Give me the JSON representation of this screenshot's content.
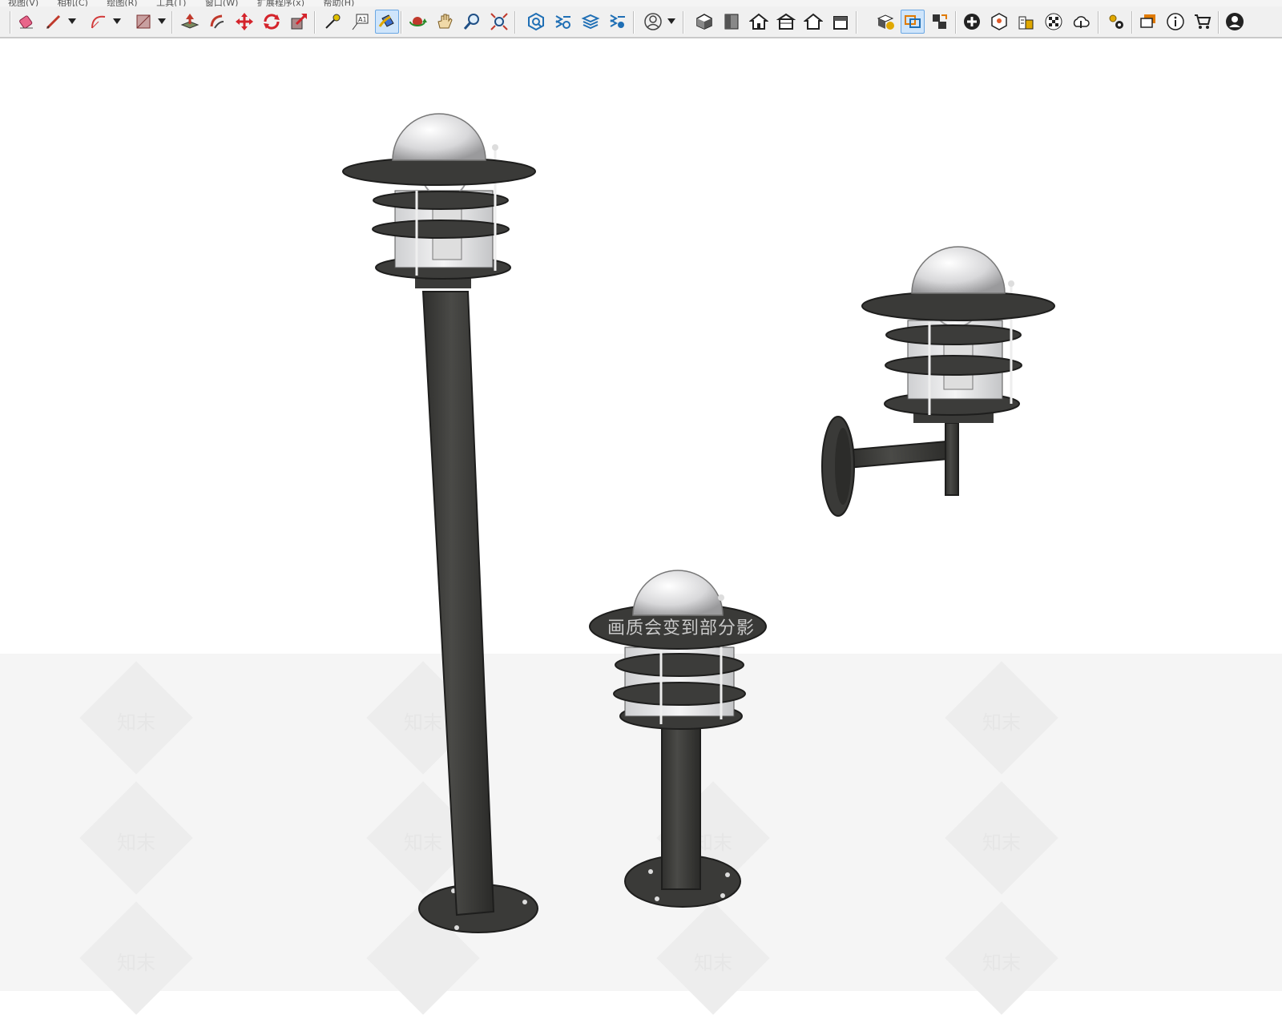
{
  "menu": {
    "items": [
      "视图(V)",
      "相机(C)",
      "绘图(R)",
      "工具(T)",
      "窗口(W)",
      "扩展程序(x)",
      "帮助(H)"
    ]
  },
  "toolbar": {
    "tools": [
      {
        "name": "eraser-icon",
        "color": "#e0406a"
      },
      {
        "name": "pencil-line-icon",
        "color": "#c0392b"
      },
      {
        "name": "arc-icon",
        "color": "#d23a3a"
      },
      {
        "name": "rectangle-icon",
        "color": "#b04040"
      },
      {
        "name": "push-pull-icon",
        "color": "#c0392b"
      },
      {
        "name": "follow-me-icon",
        "color": "#c0392b"
      },
      {
        "name": "move-icon",
        "color": "#d4232b"
      },
      {
        "name": "rotate-icon",
        "color": "#d4232b"
      },
      {
        "name": "scale-icon",
        "color": "#d4232b"
      },
      {
        "name": "tape-measure-icon",
        "color": "#d4b100"
      },
      {
        "name": "text-label-icon",
        "color": "#333333"
      },
      {
        "name": "paint-bucket-icon",
        "color": "#e0a800"
      },
      {
        "name": "orbit-icon",
        "color": "#c0392b"
      },
      {
        "name": "pan-icon",
        "color": "#e0b060"
      },
      {
        "name": "zoom-icon",
        "color": "#1f6fb5"
      },
      {
        "name": "zoom-extents-icon",
        "color": "#c0392b"
      },
      {
        "name": "warehouse-icon",
        "color": "#1f6fb5"
      },
      {
        "name": "extension-warehouse-icon",
        "color": "#1f6fb5"
      },
      {
        "name": "layers-icon",
        "color": "#1f6fb5"
      },
      {
        "name": "extension-manager-icon",
        "color": "#1f6fb5"
      },
      {
        "name": "user-account-icon",
        "color": "#444444"
      },
      {
        "name": "iso-view-icon",
        "color": "#333333"
      },
      {
        "name": "top-view-icon",
        "color": "#333333"
      },
      {
        "name": "front-view-icon",
        "color": "#333333"
      },
      {
        "name": "right-view-icon",
        "color": "#333333"
      },
      {
        "name": "back-view-icon",
        "color": "#333333"
      },
      {
        "name": "left-view-icon",
        "color": "#333333"
      },
      {
        "name": "section-plane-icon",
        "color": "#e0a800"
      },
      {
        "name": "display-section-icon",
        "color": "#1f6fb5"
      },
      {
        "name": "section-cuts-icon",
        "color": "#1f6fb5"
      },
      {
        "name": "add-location-icon",
        "color": "#222222"
      },
      {
        "name": "toggle-terrain-icon",
        "color": "#e05a2a"
      },
      {
        "name": "photo-textures-icon",
        "color": "#e0a800"
      },
      {
        "name": "checker-icon",
        "color": "#333333"
      },
      {
        "name": "cloud-upload-icon",
        "color": "#333333"
      },
      {
        "name": "settings-gears-icon",
        "color": "#e0a800"
      },
      {
        "name": "dialog-icon",
        "color": "#e07a00"
      },
      {
        "name": "info-icon",
        "color": "#333333"
      },
      {
        "name": "cart-icon",
        "color": "#333333"
      },
      {
        "name": "profile-icon",
        "color": "#333333"
      }
    ],
    "active_tools": [
      "paint-bucket-icon",
      "display-section-icon"
    ]
  },
  "viewport": {
    "watermark_text": "知末",
    "overlay_text": "画质会变到部分影",
    "model": {
      "lamp_color": "#3f3f3d",
      "glass_color": "#e8e8ea",
      "objects": [
        "tall-bollard-lamp",
        "wall-mounted-lamp",
        "short-bollard-lamp"
      ]
    }
  }
}
